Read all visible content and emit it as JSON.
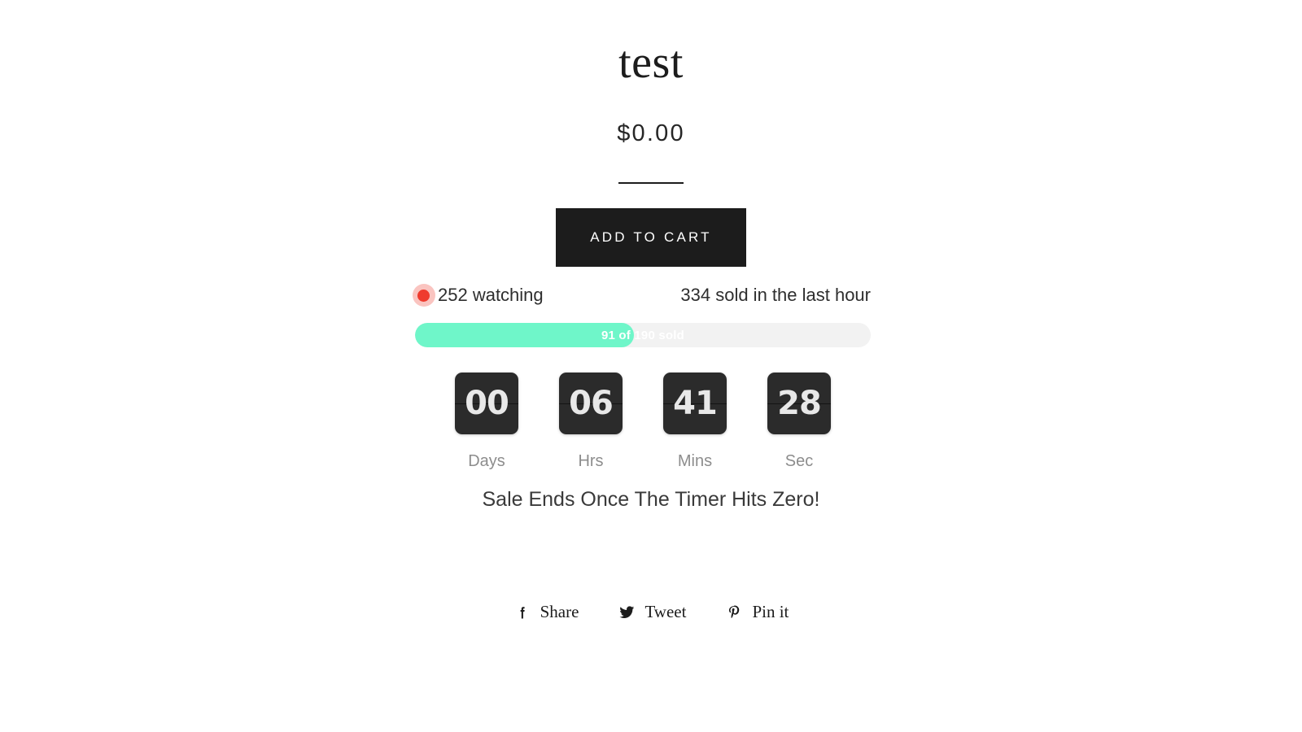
{
  "product": {
    "title": "test",
    "price": "$0.00"
  },
  "cart": {
    "add_to_cart_label": "ADD TO CART"
  },
  "social_proof": {
    "watching_text": "252 watching",
    "sold_text": "334 sold in the last hour",
    "dot_color": "#f03c2e"
  },
  "progress": {
    "label": "91 of 190 sold",
    "sold": 91,
    "total": 190,
    "percent": 48,
    "fill_color": "#6ff6c9",
    "track_color": "#f2f2f2"
  },
  "countdown": {
    "units": [
      {
        "value": "00",
        "label": "Days"
      },
      {
        "value": "06",
        "label": "Hrs"
      },
      {
        "value": "41",
        "label": "Mins"
      },
      {
        "value": "28",
        "label": "Sec"
      }
    ],
    "notice": "Sale Ends Once The Timer Hits Zero!"
  },
  "share": {
    "items": [
      {
        "icon": "facebook-icon",
        "label": "Share"
      },
      {
        "icon": "twitter-icon",
        "label": "Tweet"
      },
      {
        "icon": "pinterest-icon",
        "label": "Pin it"
      }
    ]
  }
}
